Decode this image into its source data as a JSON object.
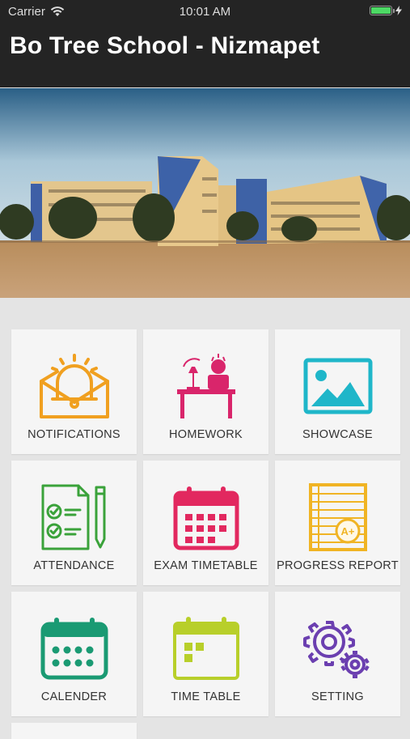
{
  "status_bar": {
    "carrier": "Carrier",
    "time": "10:01 AM"
  },
  "header": {
    "title": "Bo Tree School - Nizmapet"
  },
  "menu": [
    {
      "label": "NOTIFICATIONS",
      "icon": "notification-bell-icon",
      "color": "#f0a020"
    },
    {
      "label": "HOMEWORK",
      "icon": "homework-desk-icon",
      "color": "#d9256b"
    },
    {
      "label": "SHOWCASE",
      "icon": "gallery-image-icon",
      "color": "#1fb6c9"
    },
    {
      "label": "ATTENDANCE",
      "icon": "attendance-checklist-icon",
      "color": "#3aa23a"
    },
    {
      "label": "EXAM TIMETABLE",
      "icon": "exam-calendar-icon",
      "color": "#e2285f"
    },
    {
      "label": "PROGRESS REPORT",
      "icon": "progress-report-icon",
      "color": "#f0b424"
    },
    {
      "label": "CALENDER",
      "icon": "calendar-icon",
      "color": "#1a9a73"
    },
    {
      "label": "TIME TABLE",
      "icon": "time-table-icon",
      "color": "#b8cf2a"
    },
    {
      "label": "SETTING",
      "icon": "settings-gears-icon",
      "color": "#6b3fb0"
    }
  ]
}
